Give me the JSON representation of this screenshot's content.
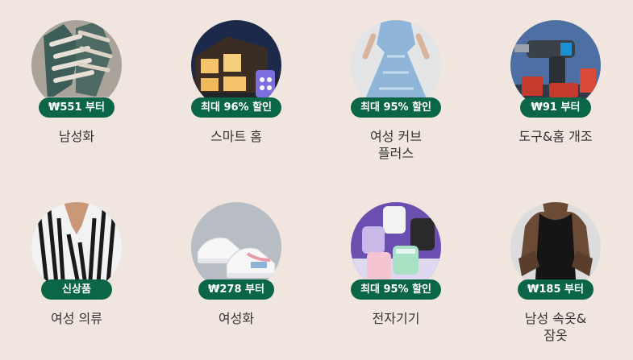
{
  "categories": [
    {
      "label": "남성화",
      "badge": "₩551 부터",
      "image": "mens-shoes-thumb"
    },
    {
      "label": "스마트 홈",
      "badge": "최대 96% 할인",
      "image": "smart-home-thumb"
    },
    {
      "label": "여성 커브 플러스",
      "badge": "최대 95% 할인",
      "image": "womens-curve-plus-thumb"
    },
    {
      "label": "도구&홈 개조",
      "badge": "₩91 부터",
      "image": "tools-home-improvement-thumb"
    },
    {
      "label": "여성 의류",
      "badge": "신상품",
      "image": "womens-clothing-thumb"
    },
    {
      "label": "여성화",
      "badge": "₩278 부터",
      "image": "womens-shoes-thumb"
    },
    {
      "label": "전자기기",
      "badge": "최대 95% 할인",
      "image": "electronics-thumb"
    },
    {
      "label": "남성 속옷&잠옷",
      "badge": "₩185 부터",
      "image": "mens-underwear-sleepwear-thumb"
    }
  ],
  "colors": {
    "background": "#f1e5e0",
    "badge": "#0a6647",
    "badge_text": "#ffffff",
    "label_text": "#333333"
  }
}
